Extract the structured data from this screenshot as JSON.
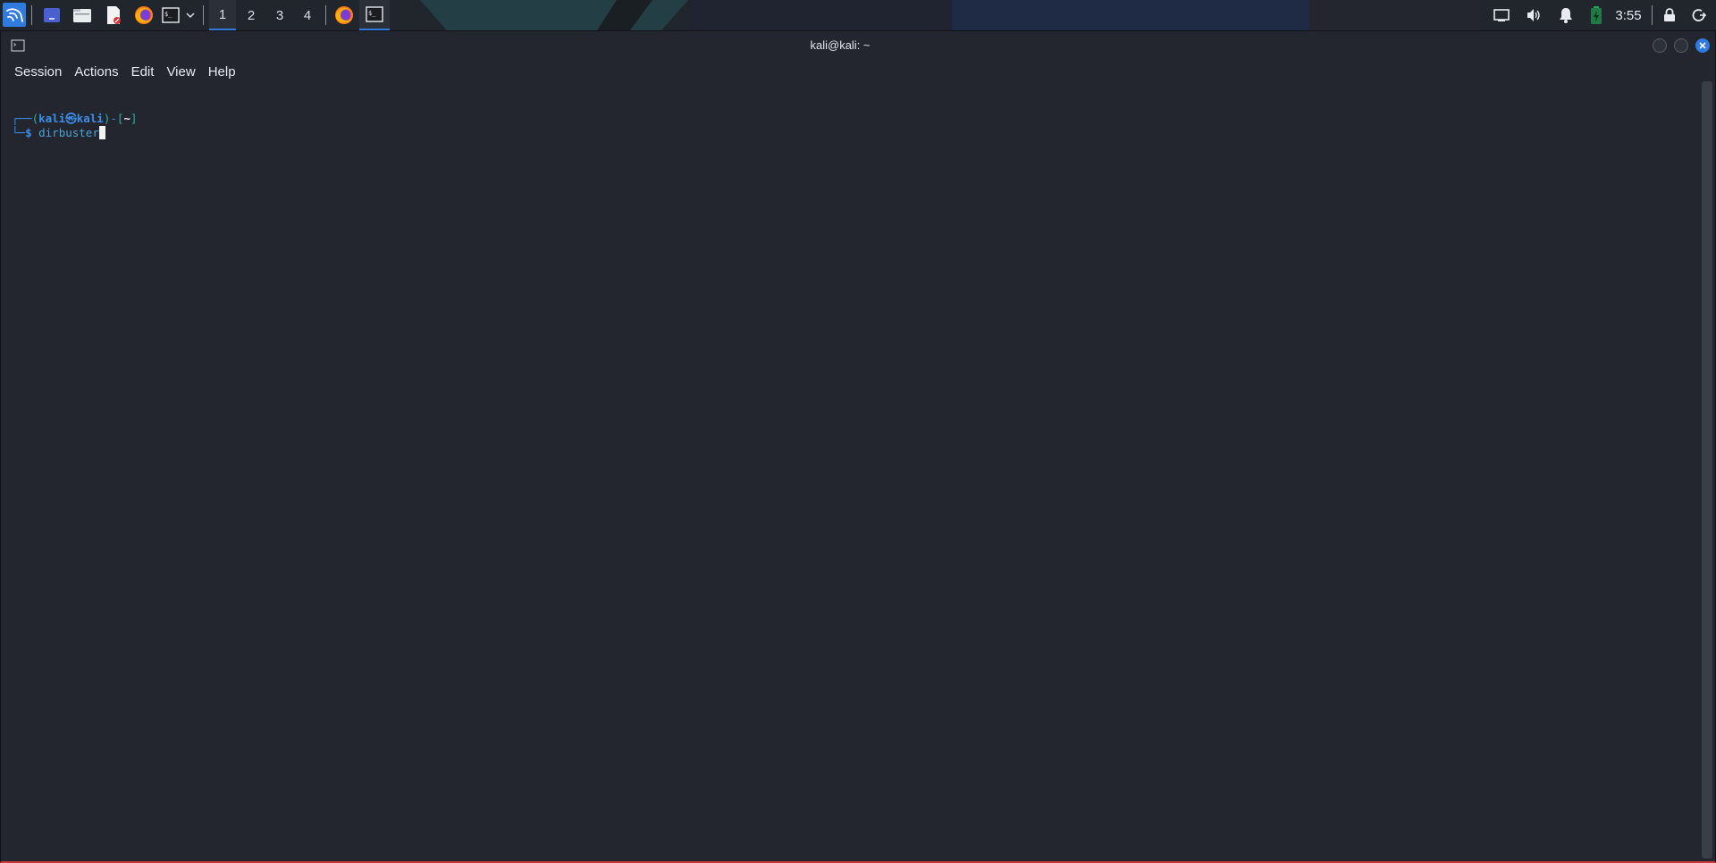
{
  "panel": {
    "workspaces": [
      "1",
      "2",
      "3",
      "4"
    ],
    "active_workspace": "1",
    "clock": "3:55",
    "launchers": [
      "kali-menu-icon",
      "desktop-icon",
      "file-manager-icon",
      "text-editor-icon",
      "firefox-icon",
      "terminal-icon",
      "dropdown-icon"
    ],
    "tasks": [
      "firefox-icon",
      "terminal-icon"
    ],
    "tray": [
      "display-icon",
      "volume-icon",
      "notification-icon",
      "battery-icon",
      "lock-icon",
      "logout-icon"
    ],
    "colors": {
      "accent": "#2f7be0",
      "panel_bg": "#21252c"
    }
  },
  "window": {
    "title": "kali@kali: ~",
    "menu": [
      "Session",
      "Actions",
      "Edit",
      "View",
      "Help"
    ]
  },
  "terminal": {
    "prompt_line1": {
      "corner": "┌──",
      "open_paren": "(",
      "user": "kali",
      "at": "㉿",
      "host": "kali",
      "close_paren": ")",
      "dash": "-",
      "open_bracket": "[",
      "cwd": "~",
      "close_bracket": "]"
    },
    "prompt_line2": {
      "corner": "└─",
      "dollar": "$",
      "command": "dirbuster"
    },
    "colors": {
      "prompt_blue": "#3b8eea",
      "prompt_teal": "#27b3a6",
      "background": "#23262e"
    }
  }
}
